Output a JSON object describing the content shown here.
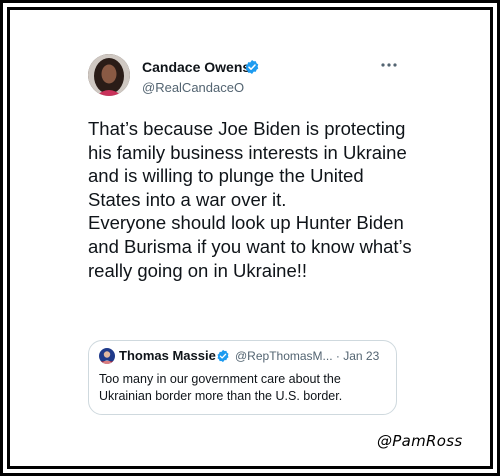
{
  "tweet": {
    "author_name": "Candace Owens",
    "author_handle": "@RealCandaceO",
    "body_paragraphs": [
      "That’s because Joe Biden is protecting his family business interests in Ukraine and is willing to plunge the United States into a war over it.",
      "Everyone should look up Hunter Biden and Burisma if you want to know what’s really going on in Ukraine!!"
    ],
    "icons": {
      "verified": "verified-badge-icon",
      "more": "more-options-icon"
    }
  },
  "quote": {
    "author_name": "Thomas Massie",
    "author_handle": "@RepThomasM...",
    "separator": "·",
    "date": "Jan 23",
    "text": "Too many in our government care about the Ukrainian border more than the U.S. border."
  },
  "watermark": "@PamRoss",
  "colors": {
    "text_primary": "#0f1419",
    "text_secondary": "#536471",
    "verified_blue": "#1d9bf0",
    "card_border": "#cfd9de",
    "frame": "#000000"
  }
}
